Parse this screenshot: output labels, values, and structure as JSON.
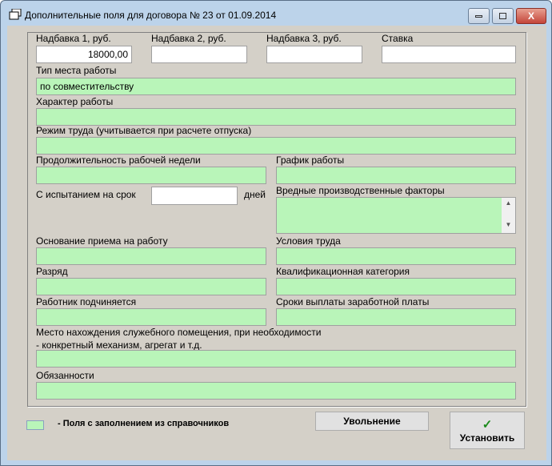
{
  "window": {
    "title": "Дополнительные поля для договора № 23 от 01.09.2014",
    "minimize": "minimize",
    "maximize": "maximize",
    "close": "X"
  },
  "fields": {
    "nadbavka1": {
      "label": "Надбавка 1, руб.",
      "value": "18000,00"
    },
    "nadbavka2": {
      "label": "Надбавка 2, руб.",
      "value": ""
    },
    "nadbavka3": {
      "label": "Надбавка 3, руб.",
      "value": ""
    },
    "stavka": {
      "label": "Ставка",
      "value": ""
    },
    "tip_mesta": {
      "label": "Тип места работы",
      "value": "по совместительству"
    },
    "harakter": {
      "label": "Характер работы",
      "value": ""
    },
    "rezhim": {
      "label": "Режим труда (учитывается при расчете отпуска)",
      "value": ""
    },
    "prodolzhitelnost": {
      "label": "Продолжительность рабочей недели",
      "value": ""
    },
    "grafik": {
      "label": "График работы",
      "value": ""
    },
    "ispytanie": {
      "label": "С испытанием на срок",
      "value": "",
      "suffix": "дней"
    },
    "vrednye": {
      "label": "Вредные производственные факторы",
      "value": ""
    },
    "osnovanie": {
      "label": "Основание приема на работу",
      "value": ""
    },
    "usloviya": {
      "label": "Условия труда",
      "value": ""
    },
    "razryad": {
      "label": "Разряд",
      "value": ""
    },
    "kvalifikaciya": {
      "label": "Квалификационная категория",
      "value": ""
    },
    "podchinyaetsya": {
      "label": "Работник подчиняется",
      "value": ""
    },
    "sroki": {
      "label": "Сроки выплаты заработной платы",
      "value": ""
    },
    "mesto": {
      "label": "Место нахождения служебного помещения, при необходимости",
      "label2": "- конкретный механизм, агрегат и т.д.",
      "value": ""
    },
    "obyazannosti": {
      "label": "Обязанности",
      "value": ""
    }
  },
  "legend": {
    "text": "-  Поля с заполнением из справочников",
    "color": "#b9f5b9"
  },
  "buttons": {
    "uvolnenie": "Увольнение",
    "ustanovit": "Установить",
    "check_icon": "✓"
  }
}
